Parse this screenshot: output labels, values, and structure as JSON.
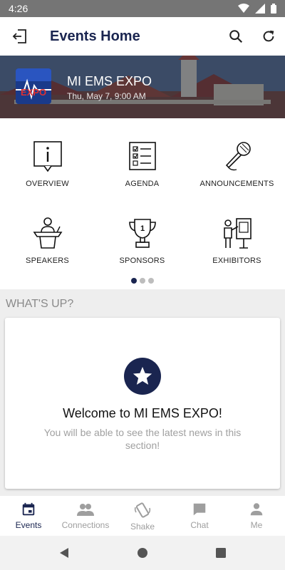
{
  "status_bar": {
    "time": "4:26"
  },
  "app_bar": {
    "title": "Events Home",
    "icons": [
      "exit-icon",
      "search-icon",
      "refresh-icon"
    ]
  },
  "event": {
    "name": "MI EMS EXPO",
    "date": "Thu, May 7, 9:00 AM",
    "logo_text": "EXPO"
  },
  "menu": [
    {
      "label": "OVERVIEW",
      "icon": "info-icon"
    },
    {
      "label": "AGENDA",
      "icon": "checklist-icon"
    },
    {
      "label": "ANNOUNCEMENTS",
      "icon": "microphone-icon"
    },
    {
      "label": "SPEAKERS",
      "icon": "podium-icon"
    },
    {
      "label": "SPONSORS",
      "icon": "trophy-icon"
    },
    {
      "label": "EXHIBITORS",
      "icon": "presenter-board-icon"
    }
  ],
  "pager": {
    "pages": 3,
    "active_page": 1
  },
  "whats_up": {
    "section_title": "WHAT'S UP?",
    "welcome": "Welcome to MI EMS EXPO!",
    "message": "You will be able to see the latest news in this section!"
  },
  "bottom_nav": [
    {
      "label": "Events",
      "icon": "calendar-icon",
      "active": true
    },
    {
      "label": "Connections",
      "icon": "people-icon",
      "active": false
    },
    {
      "label": "Shake",
      "icon": "shake-phone-icon",
      "active": false
    },
    {
      "label": "Chat",
      "icon": "chat-icon",
      "active": false
    },
    {
      "label": "Me",
      "icon": "person-icon",
      "active": false
    }
  ],
  "colors": {
    "primary": "#1a2550",
    "inactive": "#9e9e9e",
    "status_bar": "#757575"
  }
}
